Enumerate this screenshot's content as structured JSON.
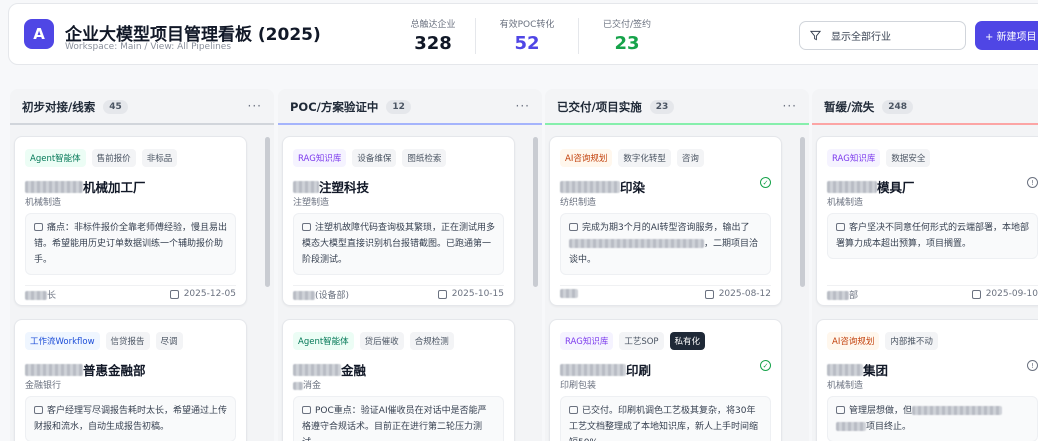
{
  "header": {
    "logo": "A",
    "title": "企业大模型项目管理看板 (2025)",
    "subtitle": "Workspace: Main / View: All Pipelines",
    "stats": [
      {
        "label": "总触达企业",
        "value": "328",
        "color": "#111827"
      },
      {
        "label": "有效POC转化",
        "value": "52",
        "color": "#4f46e5"
      },
      {
        "label": "已交付/签约",
        "value": "23",
        "color": "#16a34a"
      }
    ],
    "filter_label": "显示全部行业",
    "new_button": "+ 新建项目"
  },
  "columns": [
    {
      "title": "初步对接/线索",
      "count": "45",
      "accent": "#d1d5db",
      "cards": [
        {
          "tags": [
            {
              "text": "Agent智能体",
              "kind": "agent"
            },
            {
              "text": "售前报价",
              "kind": ""
            },
            {
              "text": "非标品",
              "kind": ""
            }
          ],
          "name_suffix": "机械加工厂",
          "industry": "机械制造",
          "note": "痛点：非标件报价全靠老师傅经验，慢且易出错。希望能用历史订单数据训练一个辅助报价助手。",
          "owner": "长",
          "date": "2025-12-05",
          "status": ""
        },
        {
          "tags": [
            {
              "text": "工作流Workflow",
              "kind": "wf"
            },
            {
              "text": "信贷报告",
              "kind": ""
            },
            {
              "text": "尽调",
              "kind": ""
            }
          ],
          "name_suffix": "普惠金融部",
          "industry": "金融银行",
          "note": "客户经理写尽调报告耗时太长，希望通过上传财报和流水，自动生成报告初稿。",
          "owner": "",
          "date": "",
          "status": ""
        }
      ]
    },
    {
      "title": "POC/方案验证中",
      "count": "12",
      "accent": "#a5b4fc",
      "cards": [
        {
          "tags": [
            {
              "text": "RAG知识库",
              "kind": "rag"
            },
            {
              "text": "设备维保",
              "kind": ""
            },
            {
              "text": "图纸检索",
              "kind": ""
            }
          ],
          "name_suffix": "注塑科技",
          "industry": "注塑制造",
          "note": "注塑机故障代码查询极其繁琐，正在测试用多模态大模型直接识别机台报错截图。已跑通第一阶段测试。",
          "owner": "(设备部)",
          "date": "2025-10-15",
          "status": ""
        },
        {
          "tags": [
            {
              "text": "Agent智能体",
              "kind": "agent"
            },
            {
              "text": "贷后催收",
              "kind": ""
            },
            {
              "text": "合规检测",
              "kind": ""
            }
          ],
          "name_suffix": "金融",
          "industry": "消金",
          "note": "POC重点：验证AI催收员在对话中是否能严格遵守合规话术。目前正在进行第二轮压力测试。",
          "owner": "",
          "date": "",
          "status": ""
        }
      ]
    },
    {
      "title": "已交付/项目实施",
      "count": "23",
      "accent": "#86efac",
      "cards": [
        {
          "tags": [
            {
              "text": "AI咨询规划",
              "kind": "ai"
            },
            {
              "text": "数字化转型",
              "kind": ""
            },
            {
              "text": "咨询",
              "kind": ""
            }
          ],
          "name_suffix": "印染",
          "industry": "纺织制造",
          "note": "完成为期3个月的AI转型咨询服务，输出了",
          "note_tail": "，二期项目洽谈中。",
          "owner": "",
          "date": "2025-08-12",
          "status": "ok"
        },
        {
          "tags": [
            {
              "text": "RAG知识库",
              "kind": "rag"
            },
            {
              "text": "工艺SOP",
              "kind": ""
            },
            {
              "text": "私有化",
              "kind": "dark"
            }
          ],
          "name_suffix": "印刷",
          "industry": "印刷包装",
          "note": "已交付。印刷机调色工艺极其复杂，将30年工艺文档整理成了本地知识库，新人上手时间缩短50%",
          "owner": "",
          "date": "",
          "status": "ok"
        }
      ]
    },
    {
      "title": "暂缓/流失",
      "count": "248",
      "accent": "#fca5a5",
      "cards": [
        {
          "tags": [
            {
              "text": "RAG知识库",
              "kind": "rag"
            },
            {
              "text": "数据安全",
              "kind": ""
            }
          ],
          "name_suffix": "模具厂",
          "industry": "机械制造",
          "note": "客户坚决不同意任何形式的云端部署，本地部署算力成本超出预算，项目搁置。",
          "owner": "部",
          "date": "2025-09-10",
          "status": "info"
        },
        {
          "tags": [
            {
              "text": "AI咨询规划",
              "kind": "ai"
            },
            {
              "text": "内部推不动",
              "kind": ""
            }
          ],
          "name_suffix": "集团",
          "industry": "机械制造",
          "note": "管理层想做，但",
          "note_tail": "项目终止。",
          "owner": "",
          "date": "",
          "status": "info"
        }
      ]
    }
  ]
}
